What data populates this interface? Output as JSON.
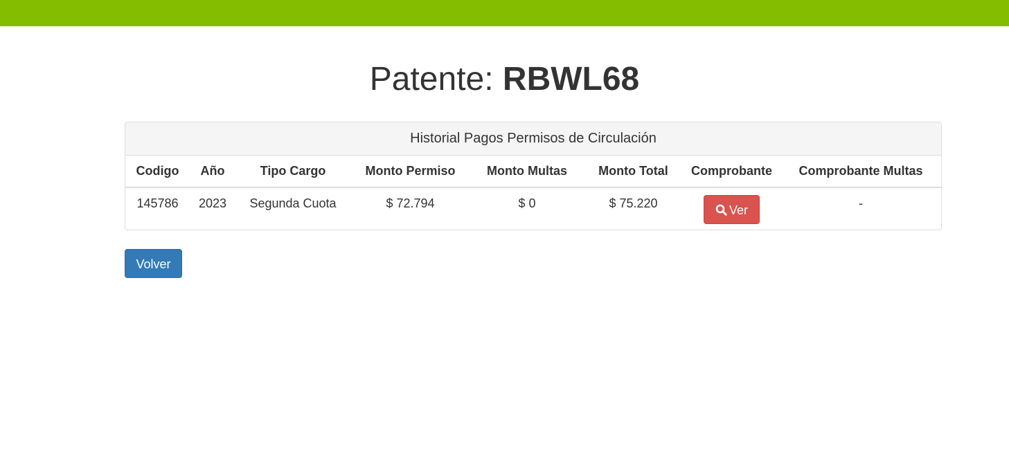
{
  "header": {
    "bar_color": "#84bd00"
  },
  "title": {
    "label": "Patente:",
    "plate": "RBWL68"
  },
  "panel": {
    "heading": "Historial Pagos Permisos de Circulación",
    "columns": [
      "Codigo",
      "Año",
      "Tipo Cargo",
      "Monto Permiso",
      "Monto Multas",
      "Monto Total",
      "Comprobante",
      "Comprobante Multas"
    ],
    "rows": [
      {
        "codigo": "145786",
        "anio": "2023",
        "tipo_cargo": "Segunda Cuota",
        "monto_permiso": "$ 72.794",
        "monto_multas": "$ 0",
        "monto_total": "$ 75.220",
        "comprobante_button": "Ver",
        "comprobante_icon": "search-icon",
        "comprobante_multas": "-"
      }
    ]
  },
  "actions": {
    "back_label": "Volver",
    "back_color": "#337ab7",
    "ver_color": "#d9534f"
  }
}
